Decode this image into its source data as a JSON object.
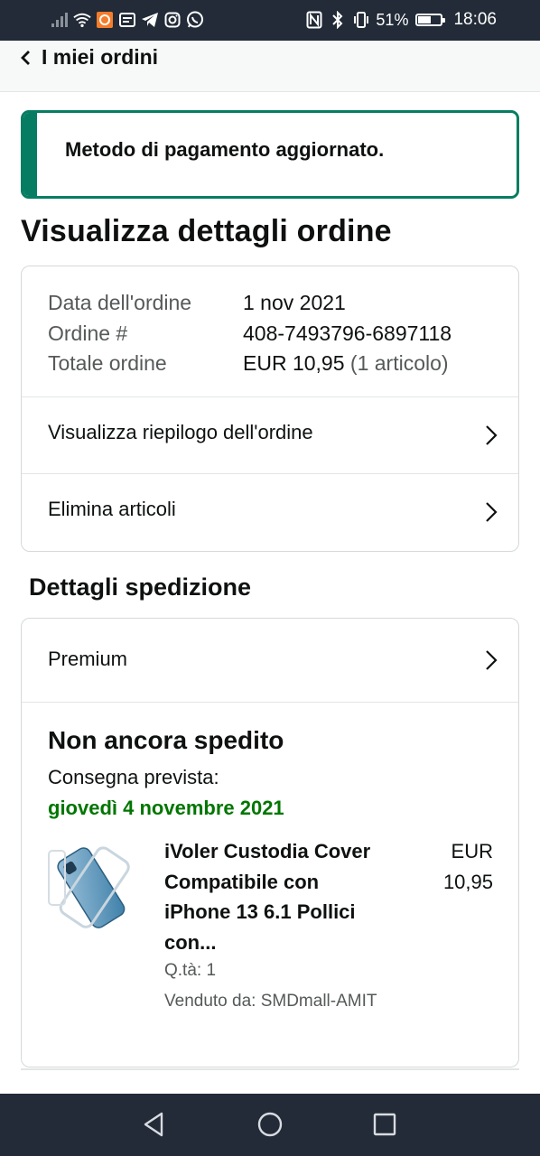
{
  "status_bar": {
    "battery_text": "51%",
    "battery_level": 0.51,
    "time": "18:06"
  },
  "header": {
    "back_label": "I miei ordini"
  },
  "alert": {
    "message": "Metodo di pagamento aggiornato.",
    "color": "#067d62"
  },
  "page": {
    "title": "Visualizza dettagli ordine"
  },
  "order": {
    "date_label": "Data dell'ordine",
    "date_value": "1 nov 2021",
    "number_label": "Ordine #",
    "number_value": "408-7493796-6897118",
    "total_label": "Totale ordine",
    "total_value": "EUR 10,95",
    "total_count": "(1 articolo)",
    "summary_link": "Visualizza riepilogo dell'ordine",
    "delete_link": "Elimina articoli"
  },
  "shipping": {
    "section_title": "Dettagli spedizione",
    "method": "Premium",
    "status": "Non ancora spedito",
    "delivery_label": "Consegna prevista:",
    "delivery_date": "giovedì 4 novembre 2021",
    "delivery_color": "#007600"
  },
  "product": {
    "name": "iVoler Custodia Cover Compatibile con iPhone 13 6.1 Pollici con...",
    "price_currency": "EUR",
    "price_value": "10,95",
    "qty": "Q.tà: 1",
    "seller": "Venduto da: SMDmall-AMIT",
    "image_icon": "phone-case-icon"
  },
  "nav": {
    "back_icon": "triangle-back-icon",
    "home_icon": "circle-home-icon",
    "recents_icon": "square-recents-icon"
  }
}
